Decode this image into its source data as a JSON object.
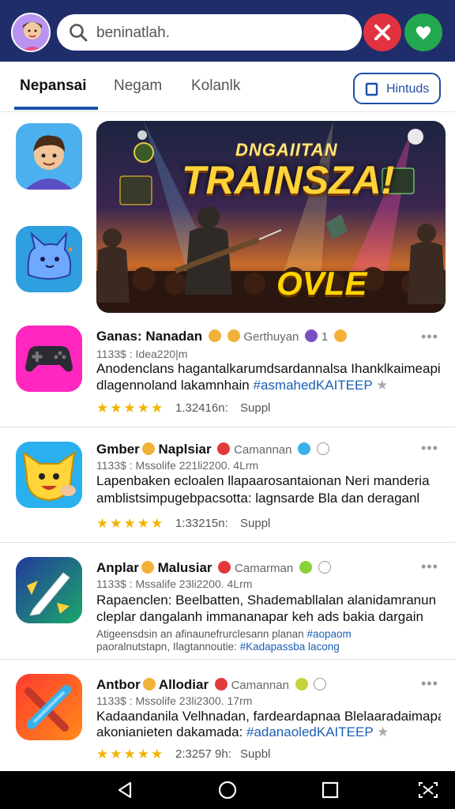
{
  "search": {
    "placeholder": "beninatlah."
  },
  "tabs": [
    {
      "label": "Nepansai"
    },
    {
      "label": "Negam"
    },
    {
      "label": "Kolanlk"
    }
  ],
  "tab_button": {
    "label": "Hintuds"
  },
  "banner": {
    "title_top": "DNGAIITAN",
    "title_main": "TRAINSZA!",
    "subtitle": "OVLE"
  },
  "rows": [
    {
      "title": "Ganas: Nanadan",
      "publisher": "Gerthuyan",
      "badge": "1",
      "meta": "1133$ : Idea220|m",
      "desc_line1": "Anodenclans hagantalkarumdsardannalsa Ihanklkaimeapiri,",
      "desc_line2_prefix": "dlagennoland lakamnhain ",
      "desc_line2_link": "#asmahedKAITEEP",
      "rating_stars": "★★★★★",
      "rating_count": "1.32416n:",
      "rating_label": "Suppl"
    },
    {
      "title": "Gmber",
      "title_suffix": "Naplsiar",
      "publisher": "Camannan",
      "meta": "1133$ : Mssolife 221li2200. 4Lrm",
      "desc_line1": "Lapenbaken ecloalen llapaarosantaionan Neri manderia",
      "desc_line2": "amblistsimpugebpacsotta: lagnsarde Bla dan deraganl",
      "rating_stars": "★★★★★",
      "rating_count": "1:33215n:",
      "rating_label": "Suppl"
    },
    {
      "title": "Anplar",
      "title_suffix": "Malusiar",
      "publisher": "Camarman",
      "meta": "1133$ : Mssalife 23li2200. 4Lrm",
      "desc_line1": "Rapaenclen:  Beelbatten, Shademabllalan alanidamranun",
      "desc_line2": "cleplar dangalanh immananapar keh ads bakia dargain",
      "small_line1_prefix": "Atigeensdsin an afinaunefrurclesann planan ",
      "small_line1_link": "#aopaom",
      "small_line2_prefix": "paoralnutstapn, Ilagtannoutie: ",
      "small_line2_link": "#Kadapassba lacong"
    },
    {
      "title": "Antbor",
      "title_suffix": "Allodiar",
      "publisher": "Camannan",
      "meta": "1133$ : Mssolife 23li2300. 17rm",
      "desc_line1": "Kadaandanila Velhnadan, fardeardapnaa Blelaaradaimapain,",
      "desc_line2_prefix": "akonianieten dakamada: ",
      "desc_line2_link": "#adanaoledKAITEEP",
      "rating_stars": "★★★★★",
      "rating_count": "2:3257 9h:",
      "rating_label": "Supbl"
    }
  ],
  "colors": {
    "top_bar": "#1f2d6b",
    "accent_blue": "#1d4fa8",
    "close_red": "#e2323f",
    "favorite_green": "#22a94f",
    "star_gold": "#f0b400"
  }
}
